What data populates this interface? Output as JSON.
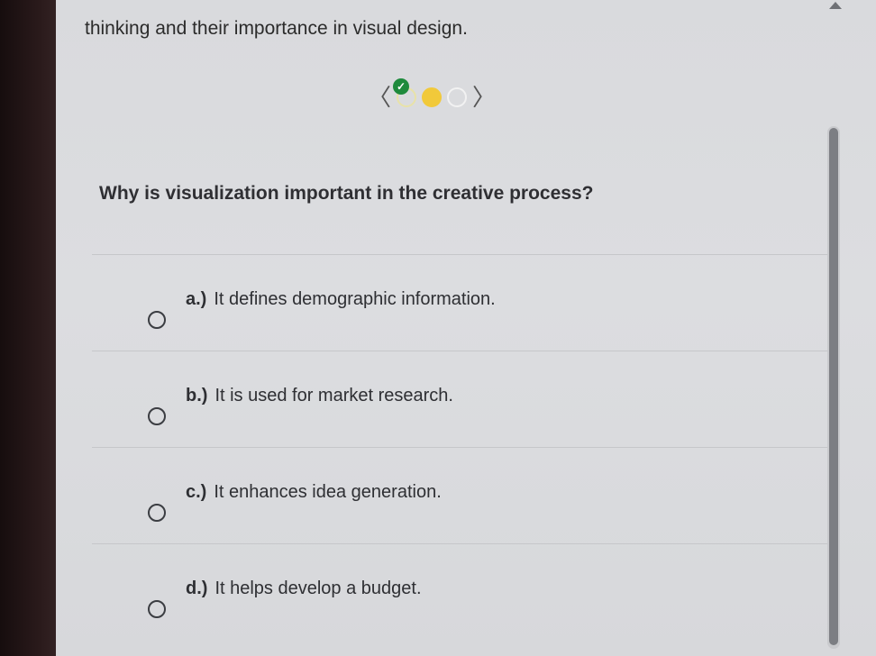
{
  "intro_text": "thinking and their importance in visual design.",
  "pager": {
    "prev_icon": "chevron-left-icon",
    "next_icon": "chevron-right-icon",
    "prev_glyph": "〈",
    "next_glyph": "〉",
    "check_glyph": "✓",
    "states": [
      "completed",
      "current",
      "not-started"
    ],
    "colors": {
      "completed_check": "#1e8a3c",
      "current": "#f1c93a",
      "empty": "#f2f2f2"
    }
  },
  "question": "Why is visualization important in the creative process?",
  "options": [
    {
      "letter": "a.)",
      "text": "It defines demographic information."
    },
    {
      "letter": "b.)",
      "text": "It is used for market research."
    },
    {
      "letter": "c.)",
      "text": "It enhances idea generation."
    },
    {
      "letter": "d.)",
      "text": "It helps develop a budget."
    }
  ]
}
